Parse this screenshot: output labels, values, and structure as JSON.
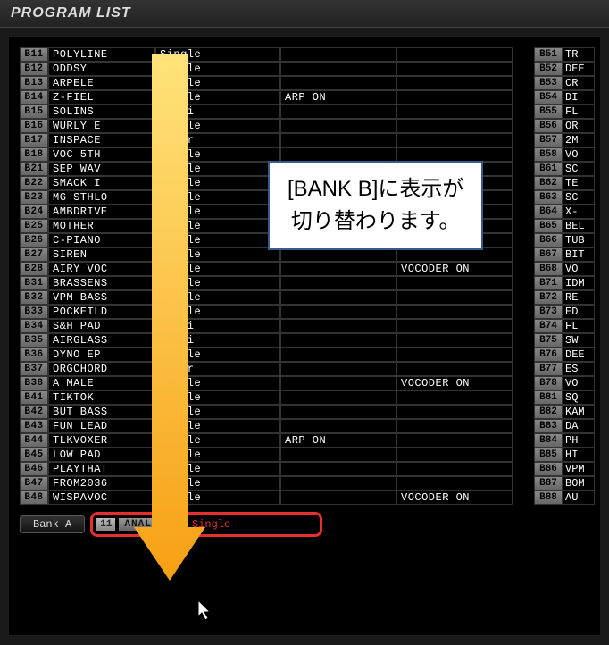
{
  "header": {
    "title": "PROGRAM LIST"
  },
  "callout": {
    "line1": "[BANK B]に表示が",
    "line2": "切り替わります。"
  },
  "footer": {
    "bank_label": "Bank A",
    "selected_slot": "11",
    "selected_name": "ANALOG",
    "selected_type": "Single"
  },
  "rows": [
    {
      "slot": "B11",
      "name": "POLYLINE",
      "type": "Single",
      "extra": "",
      "extra2": ""
    },
    {
      "slot": "B12",
      "name": "ODDSY",
      "type": "Single",
      "extra": "",
      "extra2": ""
    },
    {
      "slot": "B13",
      "name": "ARPELE",
      "type": "Single",
      "extra": "",
      "extra2": ""
    },
    {
      "slot": "B14",
      "name": "Z-FIEL",
      "type": "Single",
      "extra": "ARP ON",
      "extra2": ""
    },
    {
      "slot": "B15",
      "name": "SOLINS",
      "type": "Multi",
      "extra": "",
      "extra2": ""
    },
    {
      "slot": "B16",
      "name": "WURLY E",
      "type": "Single",
      "extra": "",
      "extra2": ""
    },
    {
      "slot": "B17",
      "name": "INSPACE",
      "type": "Layer",
      "extra": "",
      "extra2": ""
    },
    {
      "slot": "B18",
      "name": "VOC 5TH",
      "type": "Single",
      "extra": "",
      "extra2": ""
    },
    {
      "slot": "B21",
      "name": "SEP WAV",
      "type": "Single",
      "extra": "",
      "extra2": ""
    },
    {
      "slot": "B22",
      "name": "SMACK I",
      "type": "Single",
      "extra": "",
      "extra2": ""
    },
    {
      "slot": "B23",
      "name": "MG STHLO",
      "type": "Single",
      "extra": "",
      "extra2": ""
    },
    {
      "slot": "B24",
      "name": "AMBDRIVE",
      "type": "Single",
      "extra": "",
      "extra2": ""
    },
    {
      "slot": "B25",
      "name": "MOTHER",
      "type": "Single",
      "extra": "",
      "extra2": ""
    },
    {
      "slot": "B26",
      "name": "C-PIANO",
      "type": "Single",
      "extra": "",
      "extra2": ""
    },
    {
      "slot": "B27",
      "name": "SIREN",
      "type": "Single",
      "extra": "",
      "extra2": ""
    },
    {
      "slot": "B28",
      "name": "AIRY VOC",
      "type": "Single",
      "extra": "",
      "extra2": "VOCODER ON"
    },
    {
      "slot": "B31",
      "name": "BRASSENS",
      "type": "Single",
      "extra": "",
      "extra2": ""
    },
    {
      "slot": "B32",
      "name": "VPM BASS",
      "type": "Single",
      "extra": "",
      "extra2": ""
    },
    {
      "slot": "B33",
      "name": "POCKETLD",
      "type": "Single",
      "extra": "",
      "extra2": ""
    },
    {
      "slot": "B34",
      "name": "S&H PAD",
      "type": "Multi",
      "extra": "",
      "extra2": ""
    },
    {
      "slot": "B35",
      "name": "AIRGLASS",
      "type": "Multi",
      "extra": "",
      "extra2": ""
    },
    {
      "slot": "B36",
      "name": "DYNO EP",
      "type": "Single",
      "extra": "",
      "extra2": ""
    },
    {
      "slot": "B37",
      "name": "ORGCHORD",
      "type": "Layer",
      "extra": "",
      "extra2": ""
    },
    {
      "slot": "B38",
      "name": "A MALE",
      "type": "Single",
      "extra": "",
      "extra2": "VOCODER ON"
    },
    {
      "slot": "B41",
      "name": "TIKTOK",
      "type": "Single",
      "extra": "",
      "extra2": ""
    },
    {
      "slot": "B42",
      "name": "BUT BASS",
      "type": "Single",
      "extra": "",
      "extra2": ""
    },
    {
      "slot": "B43",
      "name": "FUN LEAD",
      "type": "Single",
      "extra": "",
      "extra2": ""
    },
    {
      "slot": "B44",
      "name": "TLKVOXER",
      "type": "Single",
      "extra": "ARP ON",
      "extra2": ""
    },
    {
      "slot": "B45",
      "name": "LOW PAD",
      "type": "Single",
      "extra": "",
      "extra2": ""
    },
    {
      "slot": "B46",
      "name": "PLAYTHAT",
      "type": "Single",
      "extra": "",
      "extra2": ""
    },
    {
      "slot": "B47",
      "name": "FROM2036",
      "type": "Single",
      "extra": "",
      "extra2": ""
    },
    {
      "slot": "B48",
      "name": "WISPAVOC",
      "type": "Single",
      "extra": "",
      "extra2": "VOCODER ON"
    }
  ],
  "rows_right": [
    {
      "slot": "B51",
      "name": "TR"
    },
    {
      "slot": "B52",
      "name": "DEE"
    },
    {
      "slot": "B53",
      "name": "CR"
    },
    {
      "slot": "B54",
      "name": "DI"
    },
    {
      "slot": "B55",
      "name": "FL"
    },
    {
      "slot": "B56",
      "name": "OR"
    },
    {
      "slot": "B57",
      "name": "2M"
    },
    {
      "slot": "B58",
      "name": "VO"
    },
    {
      "slot": "B61",
      "name": "SC"
    },
    {
      "slot": "B62",
      "name": "TE"
    },
    {
      "slot": "B63",
      "name": "SC"
    },
    {
      "slot": "B64",
      "name": "X-"
    },
    {
      "slot": "B65",
      "name": "BEL"
    },
    {
      "slot": "B66",
      "name": "TUB"
    },
    {
      "slot": "B67",
      "name": "BIT"
    },
    {
      "slot": "B68",
      "name": "VO"
    },
    {
      "slot": "B71",
      "name": "IDM"
    },
    {
      "slot": "B72",
      "name": "RE"
    },
    {
      "slot": "B73",
      "name": "ED"
    },
    {
      "slot": "B74",
      "name": "FL"
    },
    {
      "slot": "B75",
      "name": "SW"
    },
    {
      "slot": "B76",
      "name": "DEE"
    },
    {
      "slot": "B77",
      "name": "ES"
    },
    {
      "slot": "B78",
      "name": "VO"
    },
    {
      "slot": "B81",
      "name": "SQ"
    },
    {
      "slot": "B82",
      "name": "KAM"
    },
    {
      "slot": "B83",
      "name": "DA"
    },
    {
      "slot": "B84",
      "name": "PH"
    },
    {
      "slot": "B85",
      "name": "HI"
    },
    {
      "slot": "B86",
      "name": "VPM"
    },
    {
      "slot": "B87",
      "name": "BOM"
    },
    {
      "slot": "B88",
      "name": "AU"
    }
  ]
}
